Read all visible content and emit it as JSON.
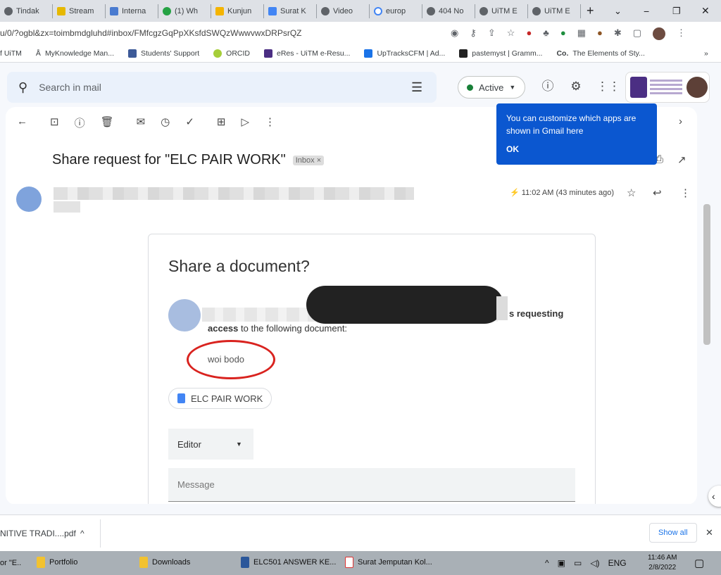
{
  "browser": {
    "tabs": [
      "Tindak",
      "Stream",
      "Interna",
      "(1) Wh",
      "Kunjun",
      "Surat K",
      "Video",
      "europ",
      "404 No",
      "UiTM E",
      "UiTM E"
    ],
    "new_tab": "+",
    "window_controls": {
      "menu": "⌄",
      "minimize": "−",
      "restore": "❐",
      "close": "✕"
    },
    "url": "u/0/?ogbl&zx=toimbmdgluhd#inbox/FMfcgzGqPpXKsfdSWQzWwwvwxDRPsrQZ",
    "bookmarks": [
      "f UiTM",
      "MyKnowledge Man...",
      "Students' Support",
      "ORCID",
      "eRes - UiTM e-Resu...",
      "UpTracksCFM | Ad...",
      "pastemyst | Gramm...",
      "The Elements of Sty..."
    ],
    "bookmarks_more": "»"
  },
  "gmail": {
    "search_placeholder": "Search in mail",
    "status": "Active",
    "tooltip": {
      "text": "You can customize which apps are shown in Gmail here",
      "ok": "OK"
    },
    "subject": "Share request for \"ELC PAIR WORK\"",
    "label": "Inbox",
    "label_remove": "×",
    "time": "11:02 AM (43 minutes ago)",
    "doc": {
      "title": "Share a document?",
      "requesting_suffix": "s requesting",
      "access_bold": "access",
      "access_rest": " to the following document:",
      "message": "woi bodo",
      "file": "ELC PAIR WORK",
      "role": "Editor",
      "message_placeholder": "Message"
    },
    "accent": "#0b57d0"
  },
  "downloads": {
    "file": "NITIVE TRADI....pdf",
    "show_all": "Show all"
  },
  "taskbar": {
    "items": [
      "or \"E..",
      "Portfolio",
      "Downloads",
      "ELC501 ANSWER KE...",
      "Surat Jemputan Kol..."
    ],
    "lang": "ENG",
    "time": "11:46 AM",
    "date": "2/8/2022"
  }
}
